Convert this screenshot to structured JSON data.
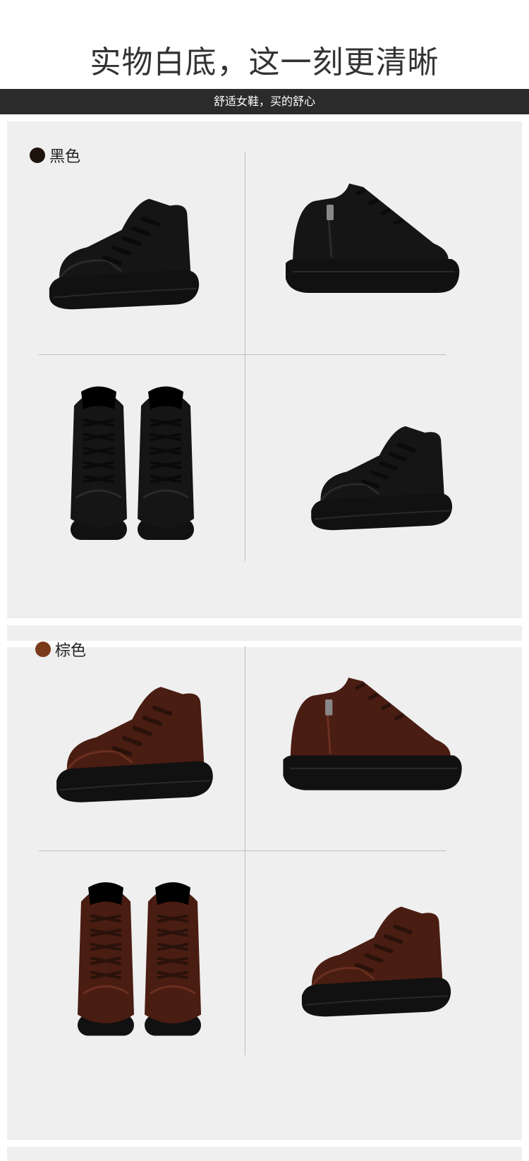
{
  "header": {
    "headline": "实物白底，这一刻更清晰",
    "banner": "舒适女鞋，买的舒心"
  },
  "variants": [
    {
      "label": "黑色",
      "swatch_color": "#1e120c",
      "upper_color": "#151515",
      "upper_shade": "#2a2a2a",
      "lace_color": "#0a0a0a",
      "sole_color": "#111111"
    },
    {
      "label": "棕色",
      "swatch_color": "#7a3a1a",
      "upper_color": "#4a1d12",
      "upper_shade": "#6b2f1f",
      "lace_color": "#2a120b",
      "sole_color": "#111111"
    }
  ],
  "colors": {
    "panel_bg": "#efefef",
    "banner_bg": "#2b2b2b",
    "divider": "#bdbdbd"
  }
}
